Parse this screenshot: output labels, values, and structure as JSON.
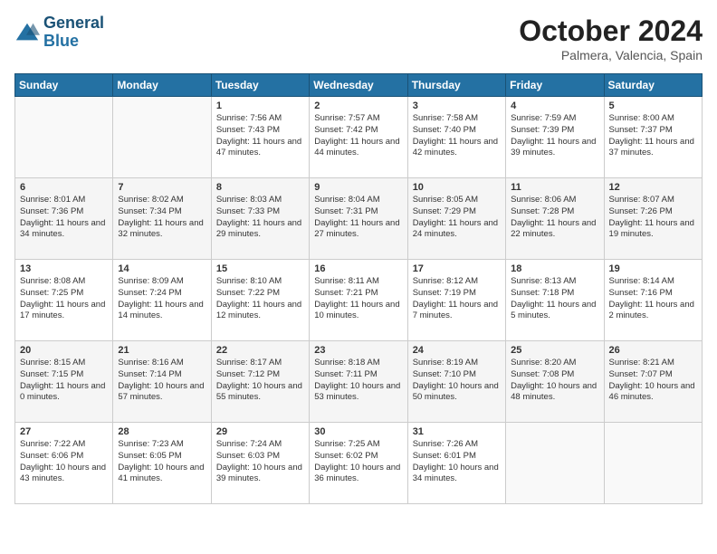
{
  "header": {
    "logo_general": "General",
    "logo_blue": "Blue",
    "month": "October 2024",
    "location": "Palmera, Valencia, Spain"
  },
  "weekdays": [
    "Sunday",
    "Monday",
    "Tuesday",
    "Wednesday",
    "Thursday",
    "Friday",
    "Saturday"
  ],
  "weeks": [
    [
      {
        "day": "",
        "info": ""
      },
      {
        "day": "",
        "info": ""
      },
      {
        "day": "1",
        "info": "Sunrise: 7:56 AM\nSunset: 7:43 PM\nDaylight: 11 hours and 47 minutes."
      },
      {
        "day": "2",
        "info": "Sunrise: 7:57 AM\nSunset: 7:42 PM\nDaylight: 11 hours and 44 minutes."
      },
      {
        "day": "3",
        "info": "Sunrise: 7:58 AM\nSunset: 7:40 PM\nDaylight: 11 hours and 42 minutes."
      },
      {
        "day": "4",
        "info": "Sunrise: 7:59 AM\nSunset: 7:39 PM\nDaylight: 11 hours and 39 minutes."
      },
      {
        "day": "5",
        "info": "Sunrise: 8:00 AM\nSunset: 7:37 PM\nDaylight: 11 hours and 37 minutes."
      }
    ],
    [
      {
        "day": "6",
        "info": "Sunrise: 8:01 AM\nSunset: 7:36 PM\nDaylight: 11 hours and 34 minutes."
      },
      {
        "day": "7",
        "info": "Sunrise: 8:02 AM\nSunset: 7:34 PM\nDaylight: 11 hours and 32 minutes."
      },
      {
        "day": "8",
        "info": "Sunrise: 8:03 AM\nSunset: 7:33 PM\nDaylight: 11 hours and 29 minutes."
      },
      {
        "day": "9",
        "info": "Sunrise: 8:04 AM\nSunset: 7:31 PM\nDaylight: 11 hours and 27 minutes."
      },
      {
        "day": "10",
        "info": "Sunrise: 8:05 AM\nSunset: 7:29 PM\nDaylight: 11 hours and 24 minutes."
      },
      {
        "day": "11",
        "info": "Sunrise: 8:06 AM\nSunset: 7:28 PM\nDaylight: 11 hours and 22 minutes."
      },
      {
        "day": "12",
        "info": "Sunrise: 8:07 AM\nSunset: 7:26 PM\nDaylight: 11 hours and 19 minutes."
      }
    ],
    [
      {
        "day": "13",
        "info": "Sunrise: 8:08 AM\nSunset: 7:25 PM\nDaylight: 11 hours and 17 minutes."
      },
      {
        "day": "14",
        "info": "Sunrise: 8:09 AM\nSunset: 7:24 PM\nDaylight: 11 hours and 14 minutes."
      },
      {
        "day": "15",
        "info": "Sunrise: 8:10 AM\nSunset: 7:22 PM\nDaylight: 11 hours and 12 minutes."
      },
      {
        "day": "16",
        "info": "Sunrise: 8:11 AM\nSunset: 7:21 PM\nDaylight: 11 hours and 10 minutes."
      },
      {
        "day": "17",
        "info": "Sunrise: 8:12 AM\nSunset: 7:19 PM\nDaylight: 11 hours and 7 minutes."
      },
      {
        "day": "18",
        "info": "Sunrise: 8:13 AM\nSunset: 7:18 PM\nDaylight: 11 hours and 5 minutes."
      },
      {
        "day": "19",
        "info": "Sunrise: 8:14 AM\nSunset: 7:16 PM\nDaylight: 11 hours and 2 minutes."
      }
    ],
    [
      {
        "day": "20",
        "info": "Sunrise: 8:15 AM\nSunset: 7:15 PM\nDaylight: 11 hours and 0 minutes."
      },
      {
        "day": "21",
        "info": "Sunrise: 8:16 AM\nSunset: 7:14 PM\nDaylight: 10 hours and 57 minutes."
      },
      {
        "day": "22",
        "info": "Sunrise: 8:17 AM\nSunset: 7:12 PM\nDaylight: 10 hours and 55 minutes."
      },
      {
        "day": "23",
        "info": "Sunrise: 8:18 AM\nSunset: 7:11 PM\nDaylight: 10 hours and 53 minutes."
      },
      {
        "day": "24",
        "info": "Sunrise: 8:19 AM\nSunset: 7:10 PM\nDaylight: 10 hours and 50 minutes."
      },
      {
        "day": "25",
        "info": "Sunrise: 8:20 AM\nSunset: 7:08 PM\nDaylight: 10 hours and 48 minutes."
      },
      {
        "day": "26",
        "info": "Sunrise: 8:21 AM\nSunset: 7:07 PM\nDaylight: 10 hours and 46 minutes."
      }
    ],
    [
      {
        "day": "27",
        "info": "Sunrise: 7:22 AM\nSunset: 6:06 PM\nDaylight: 10 hours and 43 minutes."
      },
      {
        "day": "28",
        "info": "Sunrise: 7:23 AM\nSunset: 6:05 PM\nDaylight: 10 hours and 41 minutes."
      },
      {
        "day": "29",
        "info": "Sunrise: 7:24 AM\nSunset: 6:03 PM\nDaylight: 10 hours and 39 minutes."
      },
      {
        "day": "30",
        "info": "Sunrise: 7:25 AM\nSunset: 6:02 PM\nDaylight: 10 hours and 36 minutes."
      },
      {
        "day": "31",
        "info": "Sunrise: 7:26 AM\nSunset: 6:01 PM\nDaylight: 10 hours and 34 minutes."
      },
      {
        "day": "",
        "info": ""
      },
      {
        "day": "",
        "info": ""
      }
    ]
  ]
}
